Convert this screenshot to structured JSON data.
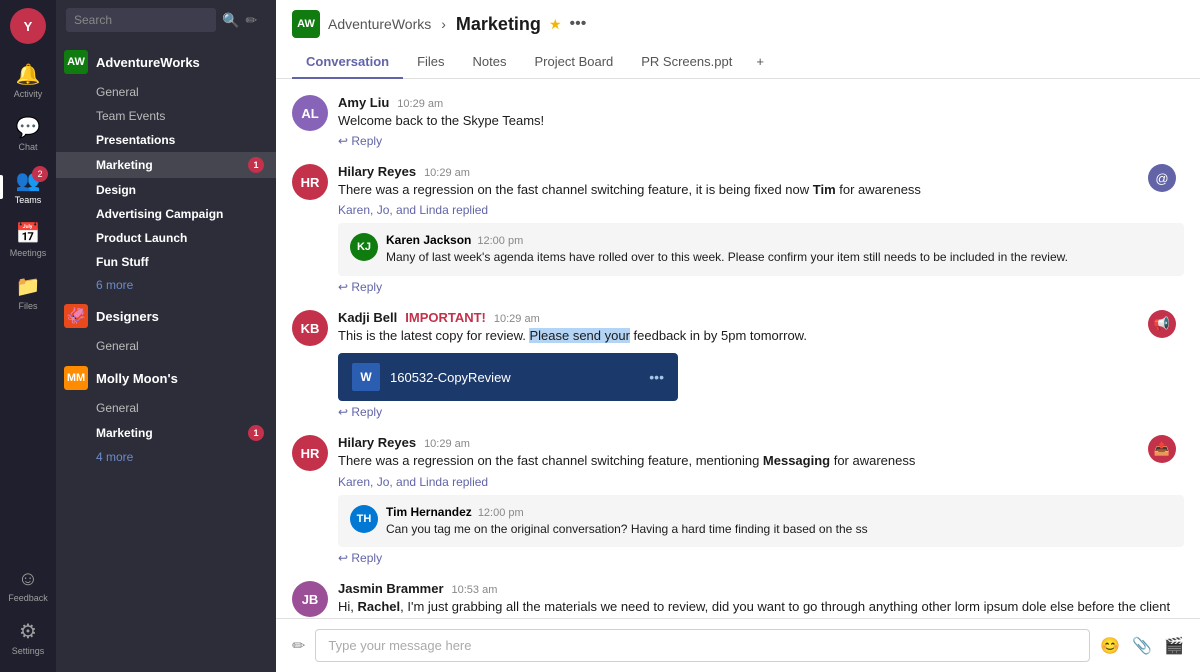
{
  "nav": {
    "items": [
      {
        "id": "activity",
        "label": "Activity",
        "icon": "🔔",
        "active": false,
        "badge": null
      },
      {
        "id": "chat",
        "label": "Chat",
        "icon": "💬",
        "active": false,
        "badge": null
      },
      {
        "id": "teams",
        "label": "Teams",
        "icon": "👥",
        "active": true,
        "badge": "2"
      },
      {
        "id": "meetings",
        "label": "Meetings",
        "icon": "📅",
        "active": false,
        "badge": null
      },
      {
        "id": "files",
        "label": "Files",
        "icon": "📁",
        "active": false,
        "badge": null
      }
    ],
    "bottom": [
      {
        "id": "feedback",
        "label": "Feedback",
        "icon": "☺"
      },
      {
        "id": "settings",
        "label": "Settings",
        "icon": "⚙"
      }
    ]
  },
  "sidebar": {
    "search_placeholder": "Search",
    "teams": [
      {
        "name": "AdventureWorks",
        "avatar_bg": "#107c10",
        "avatar_text": "AW",
        "channels": [
          {
            "name": "General",
            "bold": false,
            "badge": null
          },
          {
            "name": "Team Events",
            "bold": false,
            "badge": null
          }
        ],
        "sub_teams": [
          {
            "name": "Presentations",
            "bold": true,
            "channels": [
              {
                "name": "Marketing",
                "bold": true,
                "badge": "1",
                "active": true
              }
            ]
          },
          {
            "name": "Design",
            "bold": false,
            "channels": []
          },
          {
            "name": "Advertising Campaign",
            "bold": true,
            "channels": []
          },
          {
            "name": "Product Launch",
            "bold": true,
            "channels": []
          }
        ],
        "fun_stuff": "Fun Stuff",
        "more_link": "6 more"
      },
      {
        "name": "Designers",
        "avatar_bg": "#e8491d",
        "avatar_text": "🦑",
        "channels": [
          {
            "name": "General",
            "bold": false,
            "badge": null
          }
        ]
      },
      {
        "name": "Molly Moon's",
        "avatar_bg": "#ff8c00",
        "avatar_text": "MM",
        "channels": [
          {
            "name": "General",
            "bold": false,
            "badge": null
          },
          {
            "name": "Marketing",
            "bold": true,
            "badge": "1",
            "active": false
          }
        ],
        "more_link": "4 more"
      }
    ]
  },
  "header": {
    "team_name": "AdventureWorks",
    "channel_name": "Marketing",
    "tabs": [
      "Conversation",
      "Files",
      "Notes",
      "Project Board",
      "PR Screens.ppt"
    ],
    "active_tab": "Conversation"
  },
  "messages": [
    {
      "id": "msg1",
      "author": "Amy Liu",
      "avatar_bg": "#8764b8",
      "avatar_initials": "AL",
      "time": "10:29 am",
      "text": "Welcome back to the Skype Teams!",
      "reply_label": "Reply",
      "action_icon": null,
      "replies": []
    },
    {
      "id": "msg2",
      "author": "Hilary Reyes",
      "avatar_bg": "#c4314b",
      "avatar_initials": "HR",
      "time": "10:29 am",
      "text": "There was a regression on the fast channel switching feature, it is being fixed now Tim for awareness",
      "text_bold_word": "Tim",
      "reply_label": "Reply",
      "reply_count": "Karen, Jo, and Linda replied",
      "action_icon": "@",
      "action_icon_bg": "#6264a7",
      "replies": [
        {
          "author": "Karen Jackson",
          "avatar_bg": "#107c10",
          "avatar_initials": "KJ",
          "time": "12:00 pm",
          "text": "Many of last week's agenda items have rolled over to this week. Please confirm your item still needs to be included in the review."
        }
      ]
    },
    {
      "id": "msg3",
      "author": "Kadji Bell",
      "avatar_bg": "#c4314b",
      "avatar_initials": "KB",
      "time": "10:29 am",
      "text_pre": "This is the latest copy for review. ",
      "text_highlighted": "Please send your",
      "text_post": " feedback in by 5pm tomorrow.",
      "important_label": "IMPORTANT!",
      "reply_label": "Reply",
      "action_icon": "📢",
      "action_icon_bg": "#c4314b",
      "file": {
        "name": "160532-CopyReview",
        "icon": "W"
      }
    },
    {
      "id": "msg4",
      "author": "Hilary Reyes",
      "avatar_bg": "#c4314b",
      "avatar_initials": "HR",
      "time": "10:29 am",
      "text": "There was a regression on the fast channel switching feature, mentioning Messaging for awareness",
      "text_bold_word": "Messaging",
      "reply_label": "Reply",
      "reply_count": "Karen, Jo, and Linda replied",
      "action_icon": "📤",
      "action_icon_bg": "#c4314b",
      "replies": [
        {
          "author": "Tim Hernandez",
          "avatar_bg": "#107c10",
          "avatar_initials": "TH",
          "time": "12:00 pm",
          "text": "Can you tag me on the original conversation? Having a hard time finding it based on the ss"
        }
      ]
    },
    {
      "id": "msg5",
      "author": "Jasmin Brammer",
      "avatar_bg": "#9b4f96",
      "avatar_initials": "JB",
      "time": "10:53 am",
      "text_pre": "Hi, ",
      "text_bold": "Rachel",
      "text_post": ", I'm just grabbing all the materials we need to review, did you want to go through anything other lorm ipsum dole else before the client meeting?",
      "reply_label": "Reply"
    }
  ],
  "compose": {
    "placeholder": "Type your message here"
  }
}
